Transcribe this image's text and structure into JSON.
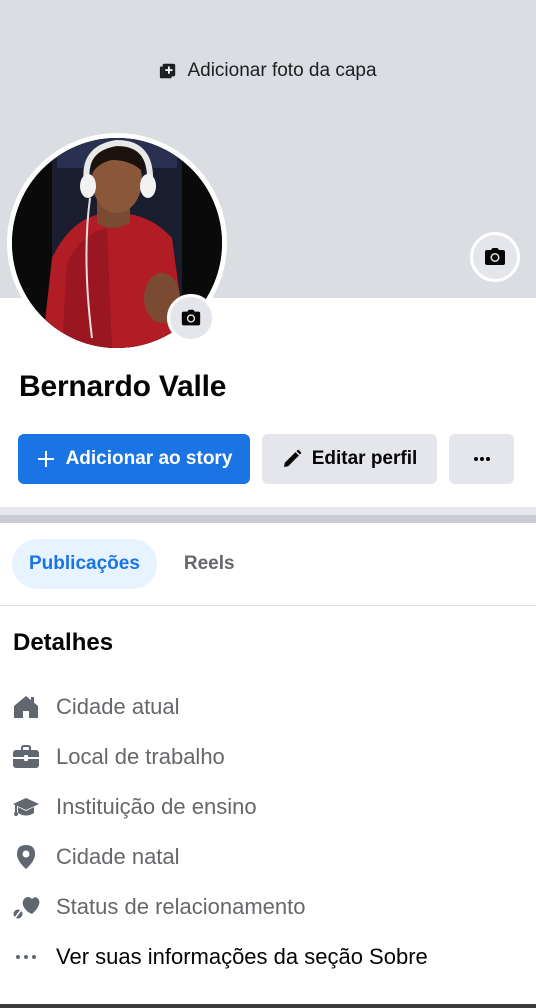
{
  "cover": {
    "add_photo_label": "Adicionar foto da capa",
    "color": "#dadde1"
  },
  "profile": {
    "name": "Bernardo Valle"
  },
  "actions": {
    "add_story_label": "Adicionar ao story",
    "edit_profile_label": "Editar perfil",
    "more_label": "•••"
  },
  "tabs": [
    {
      "label": "Publicações",
      "active": true
    },
    {
      "label": "Reels",
      "active": false
    }
  ],
  "details": {
    "title": "Detalhes",
    "items": [
      {
        "icon": "home-icon",
        "label": "Cidade atual"
      },
      {
        "icon": "briefcase-icon",
        "label": "Local de trabalho"
      },
      {
        "icon": "graduation-cap-icon",
        "label": "Instituição de ensino"
      },
      {
        "icon": "location-pin-icon",
        "label": "Cidade natal"
      },
      {
        "icon": "heart-icon",
        "label": "Status de relacionamento"
      },
      {
        "icon": "more-dots-icon",
        "label": "Ver suas informações da seção Sobre"
      }
    ]
  },
  "colors": {
    "accent": "#1b74e4",
    "accent_light": "#e7f3ff",
    "secondary_button": "#e4e6eb",
    "muted_text": "#65676b",
    "icon_gray": "#606770"
  }
}
